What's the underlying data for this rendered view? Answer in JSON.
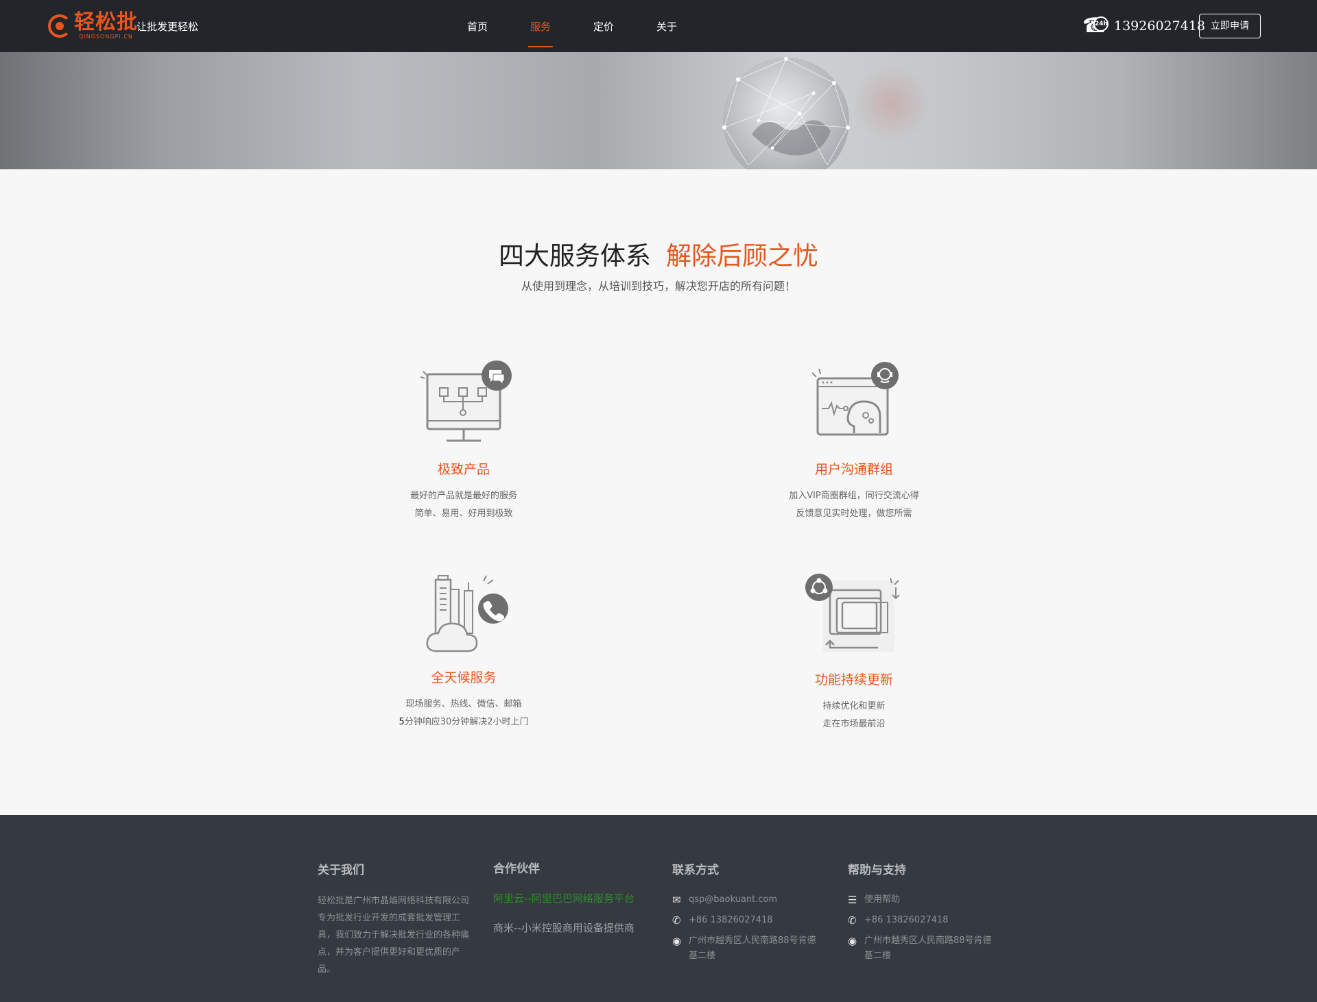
{
  "header": {
    "logo_cn": "轻松批",
    "logo_en": "QINGSONGPI.CN",
    "slogan": "让批发更轻松",
    "nav": [
      {
        "label": "首页",
        "active": false
      },
      {
        "label": "服务",
        "active": true
      },
      {
        "label": "定价",
        "active": false
      },
      {
        "label": "关于",
        "active": false
      }
    ],
    "phone_badge": "24h",
    "phone_number": "13926027418",
    "apply_button": "立即申请"
  },
  "section": {
    "title_main": "四大服务体系",
    "title_accent": "解除后顾之忧",
    "subtitle": "从使用到理念，从培训到技巧，解决您开店的所有问题！"
  },
  "services": [
    {
      "title": "极致产品",
      "line1": "最好的产品就是最好的服务",
      "line2": "简单、易用、好用到极致",
      "icon": "monitor-flowchart-icon"
    },
    {
      "title": "用户沟通群组",
      "line1": "加入VIP商圈群组，同行交流心得",
      "line2": "反馈意见实时处理，做您所需",
      "icon": "browser-brain-icon"
    },
    {
      "title": "全天候服务",
      "line1": "现场服务、热线、微信、邮箱",
      "line2_strong": "5",
      "line2": "分钟响应30分钟解决2小时上门",
      "icon": "cloud-phone-icon"
    },
    {
      "title": "功能持续更新",
      "line1": "持续优化和更新",
      "line2": "走在市场最前沿",
      "icon": "devices-sync-icon"
    }
  ],
  "footer": {
    "about": {
      "heading": "关于我们",
      "text": "轻松批是广州市晶焰网络科技有限公司专为批发行业开发的成套批发管理工具，我们致力于解决批发行业的各种痛点，并为客户提供更好和更优质的产品。"
    },
    "partners": {
      "heading": "合作伙伴",
      "links": [
        "阿里云--阿里巴巴网络服务平台",
        "商米--小米控股商用设备提供商"
      ]
    },
    "contact": {
      "heading": "联系方式",
      "email": "qsp@baokuant.com",
      "phone": "+86 13826027418",
      "address": "广州市越秀区人民南路88号肯德基二楼"
    },
    "help": {
      "heading": "帮助与支持",
      "usage": "使用帮助",
      "phone": "+86 13826027418",
      "address": "广州市越秀区人民南路88号肯德基二楼"
    }
  },
  "colors": {
    "accent": "#e8561e",
    "header_bg": "#22262b",
    "footer_bg": "#353a40",
    "partner_link": "#2f8a2c"
  }
}
